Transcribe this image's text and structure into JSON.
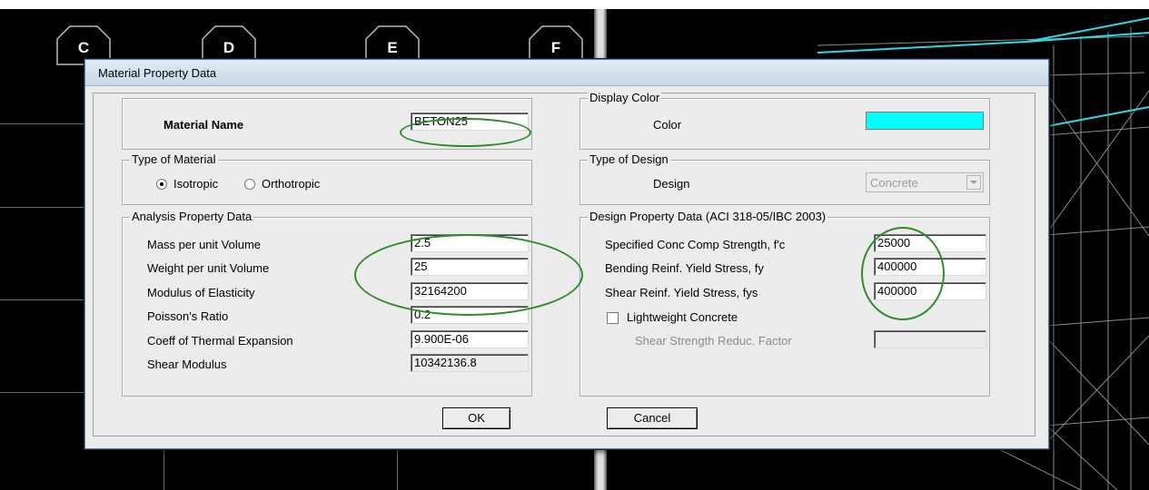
{
  "dialog": {
    "title": "Material Property Data",
    "material_name": {
      "label": "Material Name",
      "value": "BETON25"
    },
    "display_color": {
      "legend": "Display Color",
      "label": "Color",
      "value": "#00ffff"
    },
    "type_of_material": {
      "legend": "Type of Material",
      "options": [
        "Isotropic",
        "Orthotropic"
      ],
      "selected": "Isotropic"
    },
    "type_of_design": {
      "legend": "Type of Design",
      "label": "Design",
      "value": "Concrete"
    },
    "analysis": {
      "legend": "Analysis Property Data",
      "rows": [
        {
          "label": "Mass per unit Volume",
          "value": "2.5"
        },
        {
          "label": "Weight per unit Volume",
          "value": "25"
        },
        {
          "label": "Modulus of Elasticity",
          "value": "32164200"
        },
        {
          "label": "Poisson's Ratio",
          "value": "0.2"
        },
        {
          "label": "Coeff of Thermal Expansion",
          "value": "9.900E-06"
        },
        {
          "label": "Shear Modulus",
          "value": "10342136.8"
        }
      ]
    },
    "design": {
      "legend": "Design Property Data (ACI 318-05/IBC 2003)",
      "rows": [
        {
          "label": "Specified Conc Comp Strength, f'c",
          "value": "25000"
        },
        {
          "label": "Bending Reinf. Yield Stress, fy",
          "value": "400000"
        },
        {
          "label": "Shear Reinf. Yield Stress, fys",
          "value": "400000"
        }
      ],
      "lightweight_label": "Lightweight Concrete",
      "lightweight_checked": false,
      "shear_reduc_label": "Shear Strength Reduc. Factor",
      "shear_reduc_value": ""
    },
    "ok_label": "OK",
    "cancel_label": "Cancel"
  },
  "background": {
    "grid_bubbles": [
      "C",
      "D",
      "E",
      "F"
    ]
  }
}
